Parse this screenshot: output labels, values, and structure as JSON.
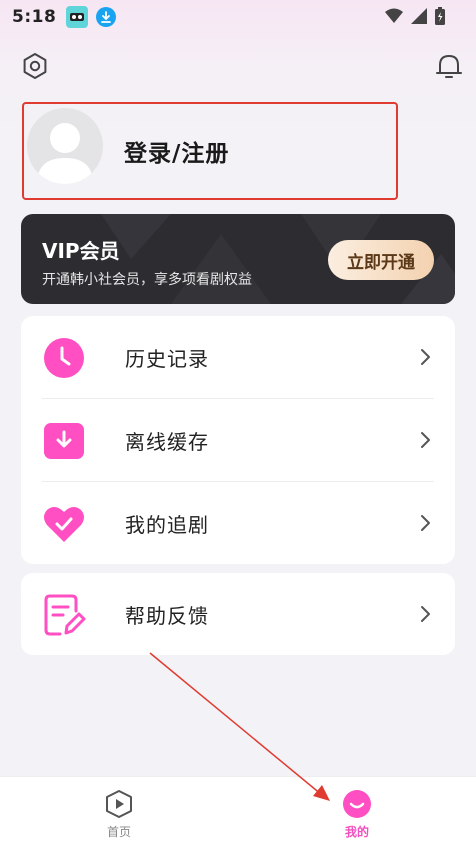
{
  "status_bar": {
    "time": "5:18"
  },
  "profile": {
    "login_label": "登录/注册"
  },
  "vip": {
    "title": "VIP会员",
    "subtitle": "开通韩小社会员，享多项看剧权益",
    "button_label": "立即开通"
  },
  "menu": {
    "items": [
      {
        "label": "历史记录",
        "icon": "clock-icon"
      },
      {
        "label": "离线缓存",
        "icon": "download-icon"
      },
      {
        "label": "我的追剧",
        "icon": "heart-icon"
      }
    ],
    "help": {
      "label": "帮助反馈",
      "icon": "feedback-icon"
    }
  },
  "tab_bar": {
    "tabs": [
      {
        "label": "首页",
        "icon": "play-icon",
        "active": false
      },
      {
        "label": "我的",
        "icon": "smile-icon",
        "active": true
      }
    ]
  },
  "colors": {
    "accent": "#ff4fc3",
    "annotation_red": "#e03b30",
    "vip_bg": "#2c2c31"
  }
}
